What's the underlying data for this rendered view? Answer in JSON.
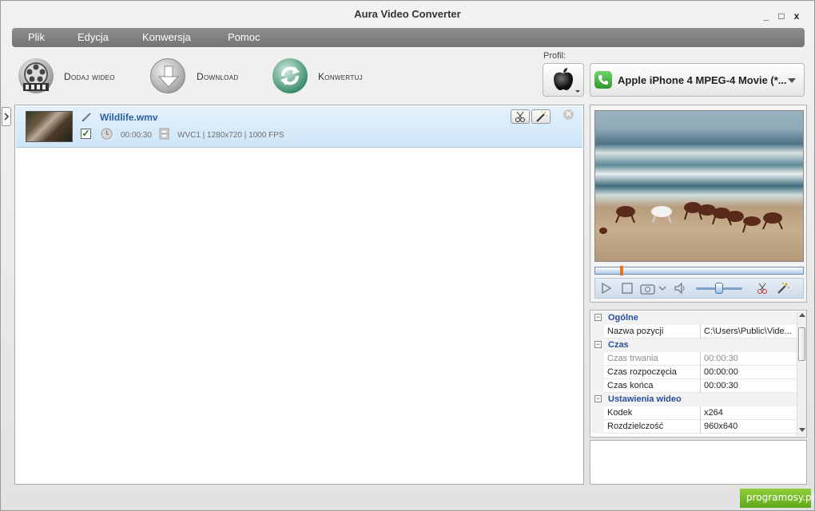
{
  "window": {
    "title": "Aura Video Converter",
    "minimize": "_",
    "maximize": "□",
    "close": "x"
  },
  "menu": [
    "Plik",
    "Edycja",
    "Konwersja",
    "Pomoc"
  ],
  "toolbar": {
    "add_video": "Dodaj wideo",
    "download": "Download",
    "convert": "Konwertuj"
  },
  "profile": {
    "label": "Profil:",
    "selected": "Apple iPhone 4 MPEG-4 Movie (*..."
  },
  "file": {
    "name": "Wildlife.wmv",
    "checked": true,
    "duration": "00:00:30",
    "info": "WVC1 | 1280x720 | 1000 FPS"
  },
  "player": {
    "seek_position": 0.12,
    "volume": 0.5
  },
  "properties": {
    "sections": [
      {
        "label": "Ogólne",
        "rows": [
          {
            "key": "Nazwa pozycji",
            "value": "C:\\Users\\Public\\Vide...",
            "dim": false
          }
        ]
      },
      {
        "label": "Czas",
        "rows": [
          {
            "key": "Czas trwania",
            "value": "00:00:30",
            "dim": true
          },
          {
            "key": "Czas rozpoczęcia",
            "value": "00:00:00",
            "dim": false
          },
          {
            "key": "Czas końca",
            "value": "00:00:30",
            "dim": false
          }
        ]
      },
      {
        "label": "Ustawienia wideo",
        "rows": [
          {
            "key": "Kodek",
            "value": "x264",
            "dim": false
          },
          {
            "key": "Rozdzielczość",
            "value": "960x640",
            "dim": false
          }
        ]
      }
    ]
  },
  "watermark": "programosy.pl",
  "colors": {
    "accent_blue": "#2b5ea8",
    "selection_bg": "#d7eaf8",
    "brand_green": "#5ea819"
  }
}
